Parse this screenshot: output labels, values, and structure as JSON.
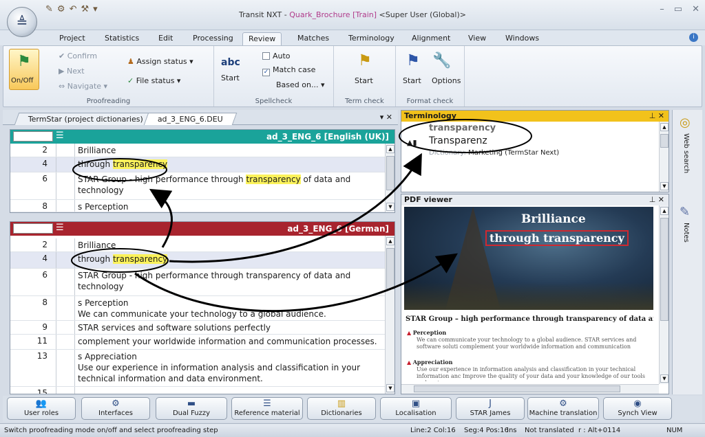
{
  "app": {
    "title_prefix": "Transit NXT - ",
    "title_project": "Quark_Brochure [Train]",
    "title_user": " <Super User (Global)>"
  },
  "tabs": [
    "Project",
    "Statistics",
    "Edit",
    "Processing",
    "Review",
    "Matches",
    "Terminology",
    "Alignment",
    "View",
    "Windows"
  ],
  "ribbon": {
    "proofreading": {
      "onoff": "On/Off",
      "confirm": "Confirm",
      "next": "Next",
      "navigate": "Navigate",
      "assign_status": "Assign status",
      "file_status": "File status",
      "label": "Proofreading"
    },
    "spellcheck": {
      "start": "Start",
      "auto": "Auto",
      "match_case": "Match case",
      "based_on": "Based on...",
      "label": "Spellcheck",
      "icon_text": "abc"
    },
    "termcheck": {
      "start": "Start",
      "label": "Term check"
    },
    "formatcheck": {
      "start": "Start",
      "options": "Options",
      "label": "Format check"
    }
  },
  "doc_tabs": [
    "TermStar (project dictionaries)",
    "ad_3_ENG_6.DEU"
  ],
  "source_pane": {
    "title": "ad_3_ENG_6 [English (UK)]",
    "rows": [
      {
        "num": "2",
        "pre": "Brilliance",
        "mark": "",
        "post": ""
      },
      {
        "num": "4",
        "pre": "through ",
        "mark": "transparency",
        "post": ""
      },
      {
        "num": "6",
        "pre": "STAR Group - high performance through ",
        "mark": "transparency",
        "post": " of data and technology"
      },
      {
        "num": "8",
        "pre": "s  Perception",
        "mark": "",
        "post": ""
      }
    ]
  },
  "target_pane": {
    "title": "ad_3_ENG_6 [German]",
    "rows": [
      {
        "num": "2",
        "pre": "Brilliance",
        "mark": "",
        "post": ""
      },
      {
        "num": "4",
        "pre": "through ",
        "mark": "transparency",
        "post": ""
      },
      {
        "num": "6",
        "pre": "STAR Group - high performance through transparency of data and technology",
        "mark": "",
        "post": ""
      },
      {
        "num": "8",
        "pre": "s  Perception",
        "mark": "",
        "post": "",
        "sub": "We can communicate your technology to a global audience."
      },
      {
        "num": "9",
        "pre": "STAR services and software solutions perfectly",
        "mark": "",
        "post": ""
      },
      {
        "num": "11",
        "pre": "complement your worldwide information and communication processes.",
        "mark": "",
        "post": ""
      },
      {
        "num": "13",
        "pre": "s  Appreciation",
        "mark": "",
        "post": "",
        "sub": "Use our experience in information analysis and classification in your technical information and data environment."
      },
      {
        "num": "15",
        "pre": "",
        "mark": "",
        "post": ""
      }
    ]
  },
  "terminology": {
    "title": "Terminology",
    "source_term": "transparency",
    "target_term": "Transparenz",
    "dict_label": "Dictionary:",
    "dict_value": "Marketing (TermStar Next)"
  },
  "pdf": {
    "title": "PDF viewer",
    "head1": "Brilliance",
    "head2": "through transparency",
    "subhead": "STAR Group – high performance through transparency of data and techn",
    "items": [
      {
        "h": "Perception",
        "t": "We can communicate your technology to a global audience. STAR services and software soluti complement your worldwide information and communication processes."
      },
      {
        "h": "Appreciation",
        "t": "Use our experience in information analysis and classification in your technical information anc Improve the quality of your data and your knowledge of our tools and systems."
      }
    ]
  },
  "sidebar": {
    "web_search": "Web search",
    "notes": "Notes"
  },
  "bottom_buttons": [
    "User roles",
    "Interfaces",
    "Dual Fuzzy",
    "Reference material",
    "Dictionaries",
    "Localisation",
    "STAR James",
    "Machine translation",
    "Synch View"
  ],
  "status": {
    "hint": "Switch proofreading mode on/off and select proofreading step",
    "pos": "Line:2 Col:16",
    "seg": "Seg:4 Pos:16",
    "ins": "Ins",
    "state": "Not translated",
    "shortcut": "r : Alt+0114",
    "num": "NUM"
  },
  "colors": {
    "source_head": "#1aa39a",
    "target_head": "#a8242e",
    "term_head": "#f2c21b"
  }
}
